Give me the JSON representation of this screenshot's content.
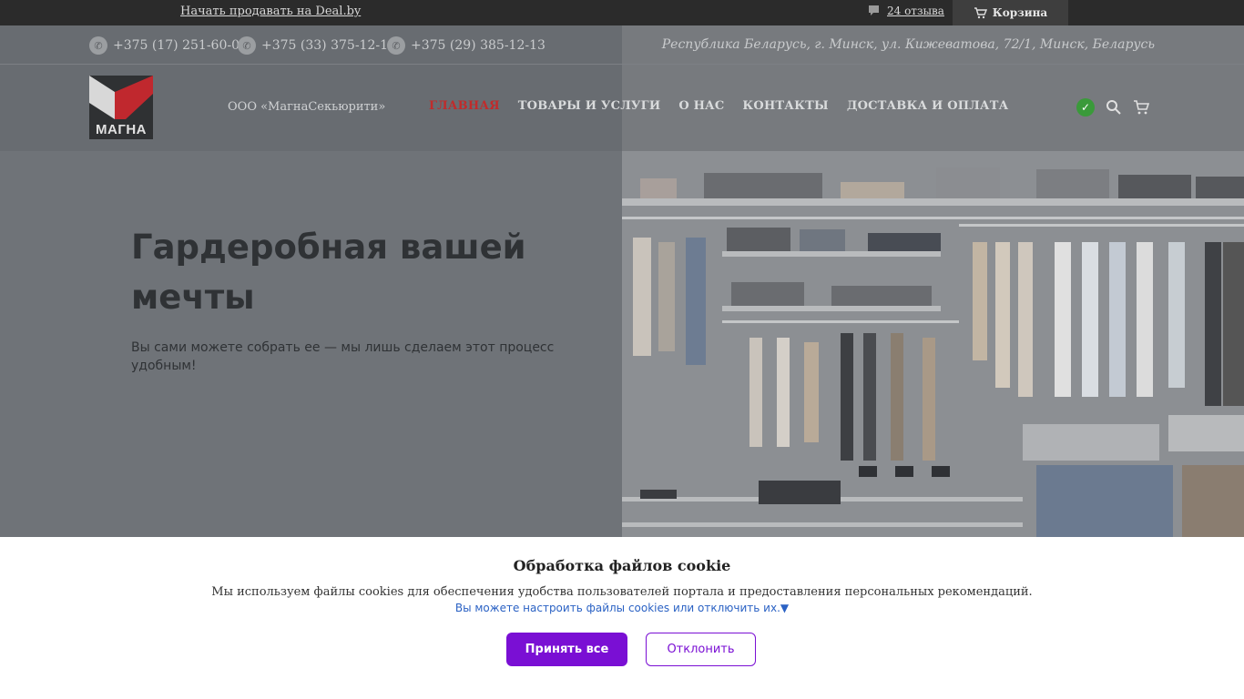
{
  "topbar": {
    "sell_link": "Начать продавать на Deal.by",
    "reviews": "24 отзыва",
    "cart": "Корзина"
  },
  "contacts": {
    "phones": [
      "+375 (17) 251-60-00",
      "+375 (33) 375-12-13",
      "+375 (29) 385-12-13"
    ],
    "address": "Республика Беларусь, г. Минск, ул. Кижеватова, 72/1, Минск, Беларусь"
  },
  "logo": {
    "text": "МАГНА"
  },
  "company": "ООО «МагнаСекьюрити»",
  "nav": [
    "ГЛАВНАЯ",
    "ТОВАРЫ И УСЛУГИ",
    "О НАС",
    "КОНТАКТЫ",
    "ДОСТАВКА И ОПЛАТА"
  ],
  "hero": {
    "title": "Гардеробная вашей мечты",
    "subtitle": "Вы сами можете собрать ее — мы лишь сделаем этот процесс удобным!"
  },
  "cookie": {
    "title": "Обработка файлов cookie",
    "text": "Мы используем файлы cookies для обеспечения удобства пользователей портала и предоставления персональных рекомендаций.",
    "link": "Вы можете настроить файлы cookies или отключить их.",
    "link_arrow": "▼",
    "accept": "Принять все",
    "decline": "Отклонить"
  },
  "colors": {
    "accent_purple": "#7a0fd4",
    "nav_active": "#c12b2b",
    "logo_red": "#c0282e"
  }
}
